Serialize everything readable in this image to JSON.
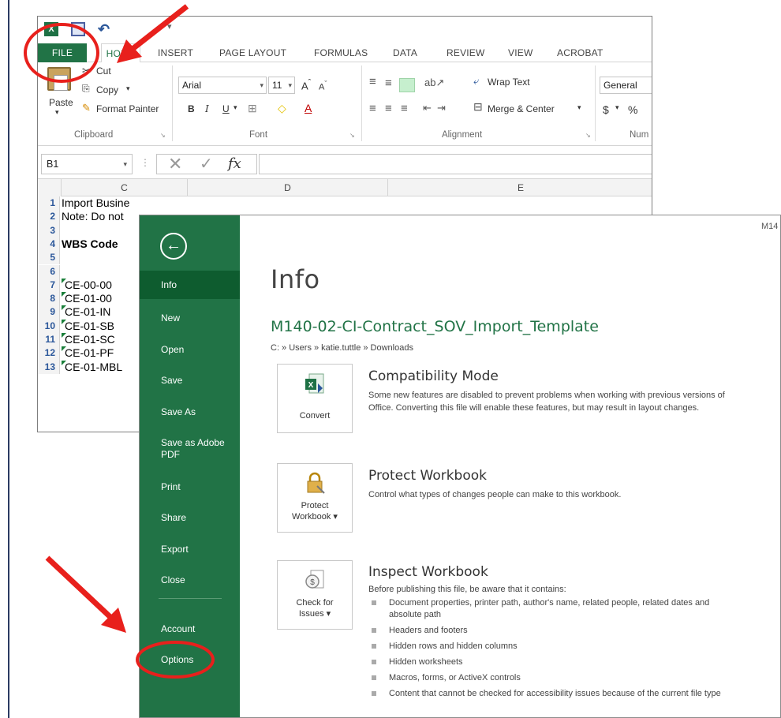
{
  "excel": {
    "tabs": [
      "FILE",
      "HOME",
      "INSERT",
      "PAGE LAYOUT",
      "FORMULAS",
      "DATA",
      "REVIEW",
      "VIEW",
      "ACROBAT"
    ],
    "clipboard": {
      "paste": "Paste",
      "cut": "Cut",
      "copy": "Copy",
      "format_painter": "Format Painter",
      "label": "Clipboard"
    },
    "font": {
      "name": "Arial",
      "size": "11",
      "bold": "B",
      "italic": "I",
      "underline": "U",
      "label": "Font"
    },
    "alignment": {
      "wrap_text": "Wrap Text",
      "merge_center": "Merge & Center",
      "label": "Alignment"
    },
    "number": {
      "format": "General",
      "currency": "$",
      "percent": "%",
      "label": "Num"
    },
    "name_box": "B1",
    "fx": "fx",
    "columns": [
      "C",
      "D",
      "E"
    ],
    "rows": [
      {
        "num": "1",
        "text": "Import Busine",
        "bold": false
      },
      {
        "num": "2",
        "text": "Note: Do not",
        "bold": false
      },
      {
        "num": "3",
        "text": "",
        "bold": false
      },
      {
        "num": "4",
        "text": "WBS Code",
        "bold": true
      },
      {
        "num": "5",
        "text": "",
        "bold": false
      },
      {
        "num": "6",
        "text": "",
        "bold": false
      },
      {
        "num": "7",
        "text": "CE-00-00",
        "bold": false
      },
      {
        "num": "8",
        "text": "CE-01-00",
        "bold": false
      },
      {
        "num": "9",
        "text": "CE-01-IN",
        "bold": false
      },
      {
        "num": "10",
        "text": "CE-01-SB",
        "bold": false
      },
      {
        "num": "11",
        "text": "CE-01-SC",
        "bold": false
      },
      {
        "num": "12",
        "text": "CE-01-PF",
        "bold": false
      },
      {
        "num": "13",
        "text": "CE-01-MBL",
        "bold": false
      }
    ]
  },
  "backstage": {
    "corner_text": "M14",
    "nav": [
      "Info",
      "New",
      "Open",
      "Save",
      "Save As",
      "Save as Adobe PDF",
      "Print",
      "Share",
      "Export",
      "Close",
      "Account",
      "Options"
    ],
    "title": "Info",
    "doc_title": "M140-02-CI-Contract_SOV_Import_Template",
    "path": "C: » Users » katie.tuttle » Downloads",
    "compat": {
      "tile": "Convert",
      "title": "Compatibility Mode",
      "text": "Some new features are disabled to prevent problems when working with previous versions of Office. Converting this file will enable these features, but may result in layout changes."
    },
    "protect": {
      "tile_line1": "Protect",
      "tile_line2": "Workbook",
      "title": "Protect Workbook",
      "text": "Control what types of changes people can make to this workbook."
    },
    "inspect": {
      "tile_line1": "Check for",
      "tile_line2": "Issues",
      "title": "Inspect Workbook",
      "text": "Before publishing this file, be aware that it contains:",
      "items": [
        "Document properties, printer path, author's name, related people, related dates and absolute path",
        "Headers and footers",
        "Hidden rows and hidden columns",
        "Hidden worksheets",
        "Macros, forms, or ActiveX controls",
        "Content that cannot be checked for accessibility issues because of the current file type"
      ]
    }
  },
  "colors": {
    "excel_green": "#217346",
    "annotation_red": "#e8201c"
  }
}
